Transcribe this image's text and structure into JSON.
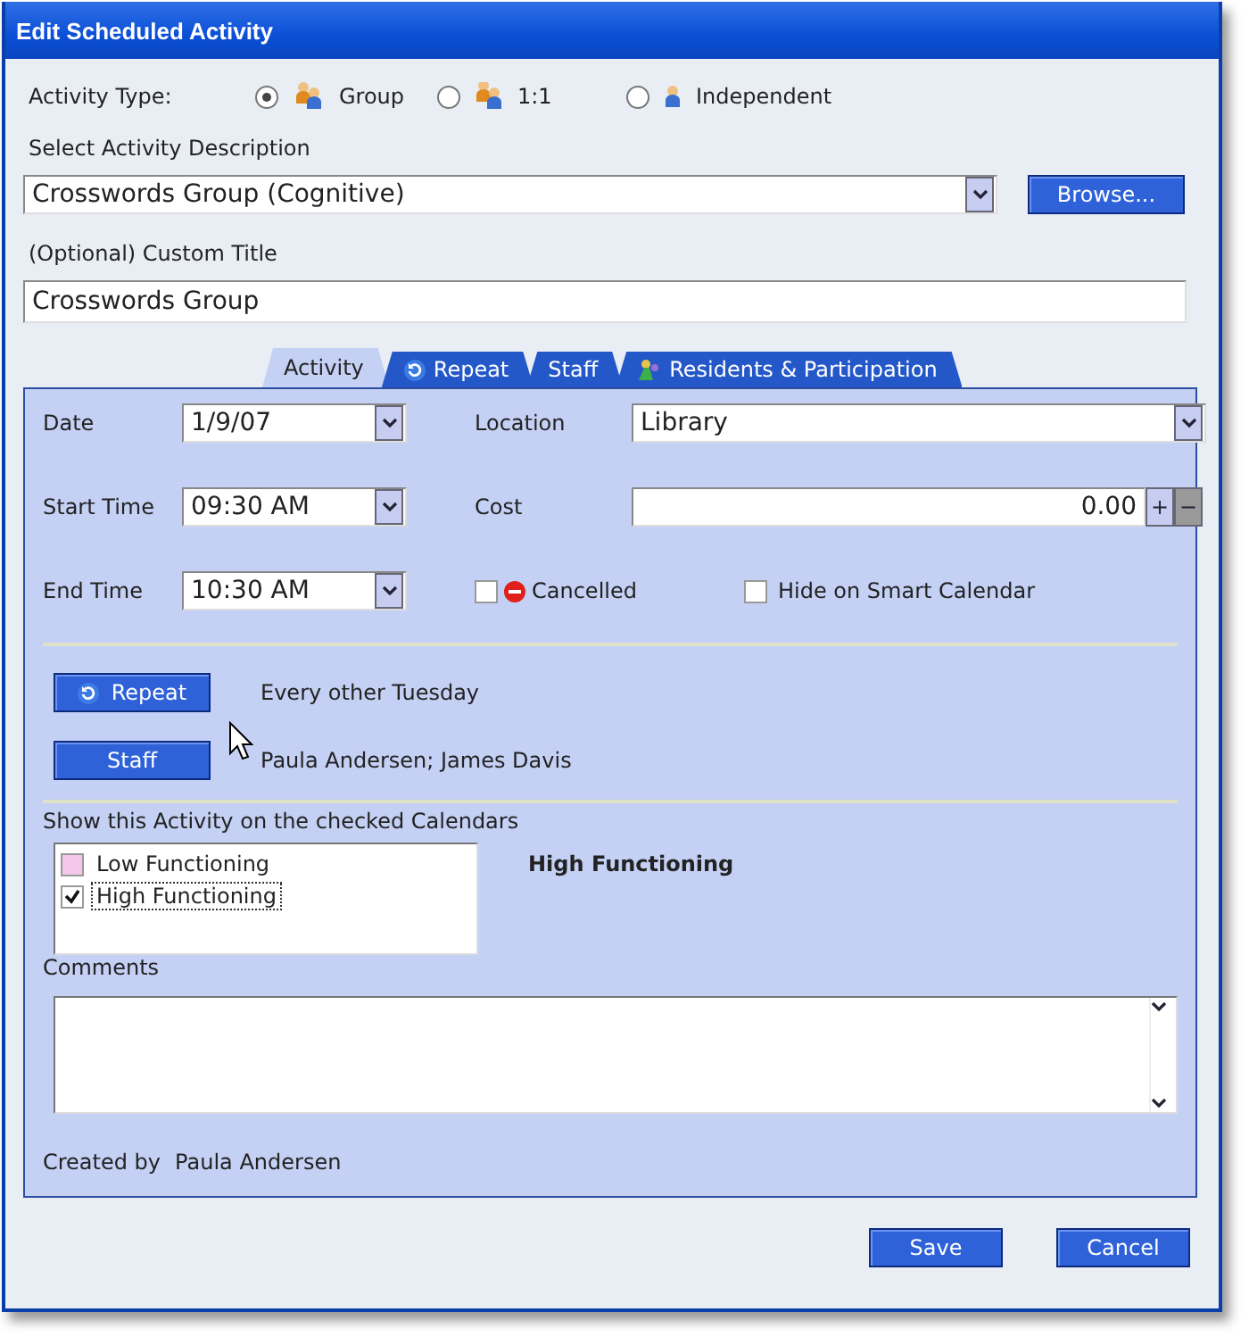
{
  "window": {
    "title": "Edit Scheduled Activity"
  },
  "activity_type": {
    "label": "Activity Type:",
    "options": [
      {
        "label": "Group",
        "selected": true,
        "kind": "group"
      },
      {
        "label": "1:1",
        "selected": false,
        "kind": "pair"
      },
      {
        "label": "Independent",
        "selected": false,
        "kind": "single"
      }
    ]
  },
  "description": {
    "label": "Select Activity Description",
    "value": "Crosswords Group (Cognitive)",
    "browse_button": "Browse..."
  },
  "custom_title": {
    "label": "(Optional) Custom Title",
    "value": "Crosswords Group"
  },
  "tabs": [
    {
      "label": "Activity",
      "selected": true,
      "kind": "plain"
    },
    {
      "label": "Repeat",
      "selected": false,
      "kind": "repeat"
    },
    {
      "label": "Staff",
      "selected": false,
      "kind": "plain"
    },
    {
      "label": "Residents & Participation",
      "selected": false,
      "kind": "people"
    }
  ],
  "date": {
    "label": "Date",
    "value": "1/9/07"
  },
  "location": {
    "label": "Location",
    "value": "Library"
  },
  "start_time": {
    "label": "Start Time",
    "value": "09:30 AM"
  },
  "cost": {
    "label": "Cost",
    "value": "0.00",
    "plus": "+",
    "minus": "−"
  },
  "end_time": {
    "label": "End Time",
    "value": "10:30 AM"
  },
  "cancelled": {
    "label": "Cancelled",
    "checked": false
  },
  "hide_on_calendar": {
    "label": "Hide on Smart Calendar",
    "checked": false
  },
  "repeat": {
    "button": "Repeat",
    "summary": "Every other Tuesday"
  },
  "staff": {
    "button": "Staff",
    "summary": "Paula Andersen; James Davis"
  },
  "calendars": {
    "label": "Show this Activity on the checked Calendars",
    "selected_name": "High Functioning",
    "items": [
      {
        "label": "Low Functioning",
        "checked": false,
        "color": "#f4c6ea"
      },
      {
        "label": "High Functioning",
        "checked": true,
        "color": "#ffffff"
      }
    ]
  },
  "comments": {
    "label": "Comments"
  },
  "created_by": {
    "label": "Created by",
    "value": "Paula Andersen"
  },
  "buttons": [
    {
      "label": "Save"
    },
    {
      "label": "Cancel"
    }
  ]
}
